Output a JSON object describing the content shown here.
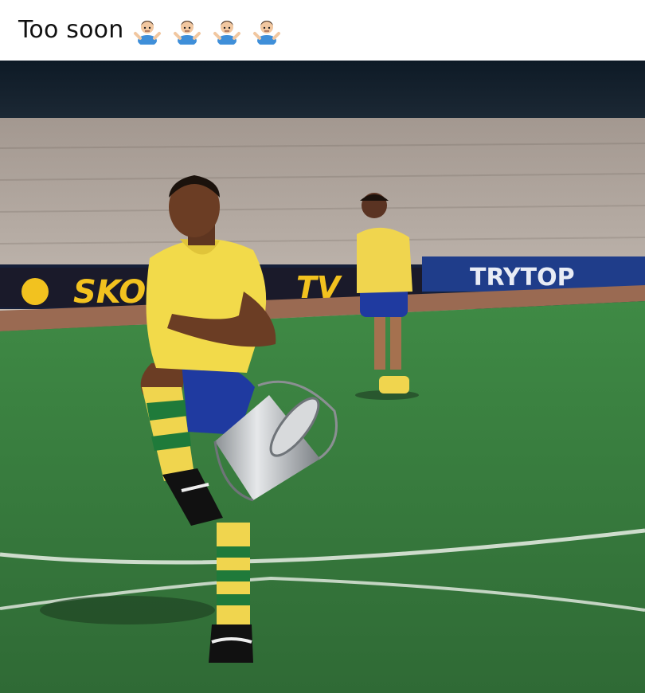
{
  "post": {
    "caption": "Too soon",
    "emoji": [
      "man-shrugging-icon",
      "man-shrugging-icon",
      "man-shrugging-icon",
      "man-shrugging-icon"
    ]
  },
  "photo": {
    "ad_boards": [
      "SKOL",
      "TV",
      "TRYTOP"
    ]
  },
  "colors": {
    "jersey": "#f2da4a",
    "shorts": "#1f3aa0",
    "grass": "#3b7a3d",
    "stands": "#b9afa6",
    "emoji_shirt": "#3f8fd9"
  }
}
